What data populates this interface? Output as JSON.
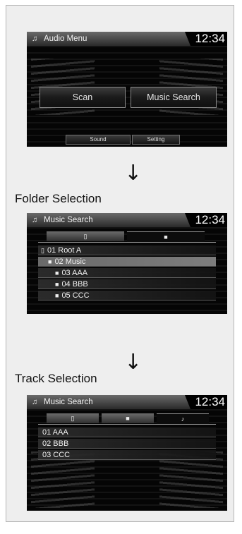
{
  "screen1": {
    "title": "Audio Menu",
    "clock": "12:34",
    "scan_label": "Scan",
    "music_search_label": "Music Search",
    "sound_label": "Sound",
    "setting_label": "Setting"
  },
  "captions": {
    "folder": "Folder Selection",
    "track": "Track Selection"
  },
  "screen2": {
    "title": "Music Search",
    "clock": "12:34",
    "tabs": [
      "device-icon",
      "folder-icon"
    ],
    "items": [
      {
        "label": "01 Root A",
        "icon": "device-icon"
      },
      {
        "label": "02 Music",
        "icon": "folder-icon"
      },
      {
        "label": "03 AAA",
        "icon": "folder-icon"
      },
      {
        "label": "04 BBB",
        "icon": "folder-icon"
      },
      {
        "label": "05 CCC",
        "icon": "folder-icon"
      }
    ]
  },
  "screen3": {
    "title": "Music Search",
    "clock": "12:34",
    "tabs": [
      "device-icon",
      "folder-icon",
      "music-note-icon"
    ],
    "items": [
      "01 AAA",
      "02 BBB",
      "03 CCC"
    ]
  }
}
